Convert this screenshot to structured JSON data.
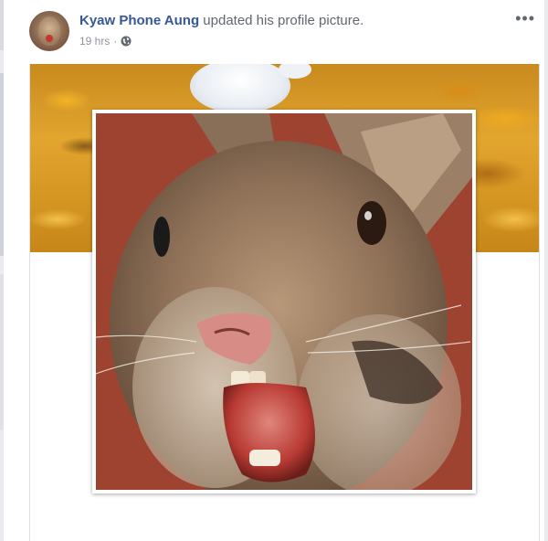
{
  "post": {
    "author": "Kyaw Phone Aung",
    "action_text": " updated his profile picture.",
    "timestamp": "19 hrs",
    "separator": "·",
    "privacy_icon": "globe-icon",
    "more_label": "•••"
  },
  "images": {
    "avatar": "rabbit-avatar",
    "cover": "autumn-leaves-cover",
    "profile": "screaming-rabbit-photo"
  },
  "colors": {
    "author_link": "#365899",
    "secondary_text": "#616770",
    "meta_text": "#90949c",
    "profile_background": "#9e4330"
  }
}
